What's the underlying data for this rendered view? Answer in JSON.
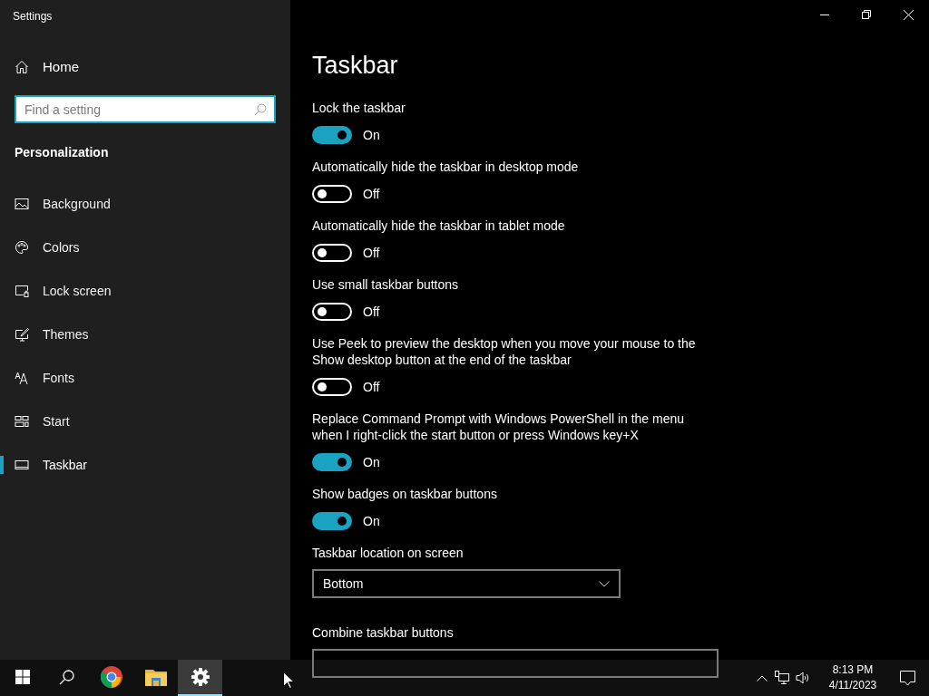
{
  "window": {
    "title": "Settings"
  },
  "sidebar": {
    "home": "Home",
    "search": {
      "placeholder": "Find a setting"
    },
    "section": "Personalization",
    "items": [
      {
        "label": "Background",
        "selected": false
      },
      {
        "label": "Colors",
        "selected": false
      },
      {
        "label": "Lock screen",
        "selected": false
      },
      {
        "label": "Themes",
        "selected": false
      },
      {
        "label": "Fonts",
        "selected": false
      },
      {
        "label": "Start",
        "selected": false
      },
      {
        "label": "Taskbar",
        "selected": true
      }
    ]
  },
  "page": {
    "title": "Taskbar",
    "settings": [
      {
        "kind": "toggle",
        "label": "Lock the taskbar",
        "on": true,
        "state": "On"
      },
      {
        "kind": "toggle",
        "label": "Automatically hide the taskbar in desktop mode",
        "on": false,
        "state": "Off"
      },
      {
        "kind": "toggle",
        "label": "Automatically hide the taskbar in tablet mode",
        "on": false,
        "state": "Off"
      },
      {
        "kind": "toggle",
        "label": "Use small taskbar buttons",
        "on": false,
        "state": "Off"
      },
      {
        "kind": "toggle",
        "label": "Use Peek to preview the desktop when you move your mouse to the Show desktop button at the end of the taskbar",
        "on": false,
        "state": "Off"
      },
      {
        "kind": "toggle",
        "label": "Replace Command Prompt with Windows PowerShell in the menu when I right-click the start button or press Windows key+X",
        "on": true,
        "state": "On"
      },
      {
        "kind": "toggle",
        "label": "Show badges on taskbar buttons",
        "on": true,
        "state": "On"
      },
      {
        "kind": "dropdown",
        "label": "Taskbar location on screen",
        "value": "Bottom"
      },
      {
        "kind": "dropdown",
        "label": "Combine taskbar buttons"
      }
    ]
  },
  "taskbar": {
    "apps": [
      {
        "selected": false
      },
      {
        "selected": false
      },
      {
        "selected": false
      },
      {
        "selected": false
      },
      {
        "selected": true
      }
    ],
    "time": "8:13 PM",
    "date": "4/11/2023"
  }
}
